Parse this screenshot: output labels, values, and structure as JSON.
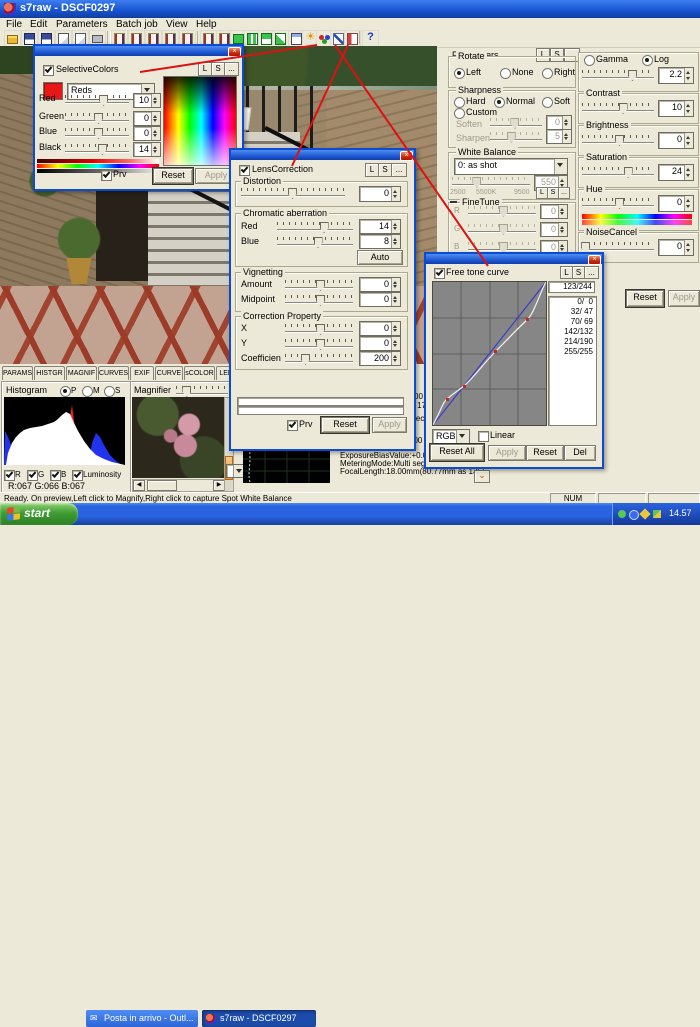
{
  "window": {
    "title": "s7raw - DSCF0297"
  },
  "menu": {
    "items": [
      "File",
      "Edit",
      "Parameters",
      "Batch job",
      "View",
      "Help"
    ]
  },
  "toolbar": {
    "icons": [
      "open-folder",
      "save",
      "save-as",
      "copy",
      "copy-settings",
      "print",
      "raw-develop-1",
      "raw-develop-2",
      "raw-develop-3",
      "raw-develop-4",
      "raw-develop-5",
      "raw-develop-6",
      "raw-develop-7",
      "preview-monitor",
      "grid-view",
      "split-view",
      "multi-view",
      "tile-windows",
      "highlight-warning",
      "selective-color",
      "tone-curve",
      "lens-correction",
      "help"
    ]
  },
  "lsm": {
    "l": "L",
    "s": "S",
    "more": "..."
  },
  "selective_color": {
    "title": "SelectiveColors",
    "channel": "Reds",
    "rows": [
      {
        "label": "Red",
        "value": "10"
      },
      {
        "label": "Green",
        "value": "0"
      },
      {
        "label": "Blue",
        "value": "0"
      },
      {
        "label": "Black",
        "value": "14"
      }
    ],
    "prv": "Prv",
    "reset": "Reset",
    "apply": "Apply"
  },
  "lens_correction": {
    "title": "LensCorrection",
    "distortion": {
      "title": "Distortion",
      "value": "0"
    },
    "chromatic": {
      "title": "Chromatic aberration",
      "rows": [
        {
          "label": "Red",
          "value": "14"
        },
        {
          "label": "Blue",
          "value": "8"
        }
      ],
      "auto": "Auto"
    },
    "vignetting": {
      "title": "Vignetting",
      "rows": [
        {
          "label": "Amount",
          "value": "0"
        },
        {
          "label": "Midpoint",
          "value": "0"
        }
      ]
    },
    "correction": {
      "title": "Correction Property",
      "rows": [
        {
          "label": "X",
          "value": "0"
        },
        {
          "label": "Y",
          "value": "0"
        },
        {
          "label": "Coefficien",
          "value": "200"
        }
      ]
    },
    "prv": "Prv",
    "reset": "Reset",
    "apply": "Apply"
  },
  "tone_curve": {
    "title": "Free tone curve",
    "readout": "123/244",
    "points": [
      "0/  0",
      "32/ 47",
      "70/ 69",
      "142/132",
      "214/190",
      "255/255"
    ],
    "channel": "RGB",
    "linear": "Linear",
    "reset_all": "Reset All",
    "apply": "Apply",
    "reset": "Reset",
    "del": "Del"
  },
  "parameters": {
    "title": "Parameters",
    "rotate": {
      "title": "Rotate",
      "left": "Left",
      "none": "None",
      "right": "Right"
    },
    "sharpness": {
      "title": "Sharpness",
      "hard": "Hard",
      "normal": "Normal",
      "soft": "Soft",
      "custom": "Custom",
      "soften": {
        "label": "Soften",
        "value": "0"
      },
      "sharpen": {
        "label": "Sharpen",
        "value": "5"
      }
    },
    "white_balance": {
      "title": "White Balance",
      "preset": "0: as shot",
      "value": "550",
      "scale": [
        "2500",
        "5500K",
        "9500"
      ]
    },
    "finetune": {
      "title": "FineTune",
      "rows": [
        {
          "label": "R",
          "value": "0"
        },
        {
          "label": "G",
          "value": "0"
        },
        {
          "label": "B",
          "value": "0"
        }
      ]
    },
    "gamma": {
      "label": "Gamma",
      "log": "Log",
      "value": "2.2"
    },
    "contrast": {
      "label": "Contrast",
      "value": "10"
    },
    "brightness": {
      "label": "Brightness",
      "value": "0"
    },
    "saturation": {
      "label": "Saturation",
      "value": "24"
    },
    "hue": {
      "label": "Hue",
      "value": "0"
    },
    "noise_cancel": {
      "label": "NoiseCancel",
      "value": "0"
    },
    "reset": "Reset",
    "apply": "Apply"
  },
  "dock": {
    "tabs": [
      "PARAMS",
      "HISTGR",
      "MAGNIF",
      "CURVES",
      "EXIF",
      "CURVE",
      "sCOLOR",
      "LENS"
    ],
    "histogram": {
      "title": "Histogram",
      "mode_p": "P",
      "mode_m": "M",
      "mode_s": "S",
      "ch_r": "R",
      "ch_g": "G",
      "ch_b": "B",
      "ch_lum": "Luminosity",
      "readout": "R:067 G:066 B:067"
    },
    "magnifier": {
      "title": "Magnifier"
    }
  },
  "exif": {
    "fragments": [
      "00",
      "17 17",
      "20sec",
      "400"
    ],
    "lines": [
      "ExposureBiasValue:+0.0",
      "MeteringMode:Multi segm",
      "FocalLength:18.00mm(80.77mm as 135)"
    ]
  },
  "status_bar": {
    "message": "Ready. On preview,Left click to Magnify,Right click to capture Spot White Balance",
    "num": "NUM"
  },
  "taskbar": {
    "start": "start",
    "tasks": [
      "Posta in arrivo - Outl...",
      "s7raw - DSCF0297"
    ],
    "clock": "14.57"
  }
}
